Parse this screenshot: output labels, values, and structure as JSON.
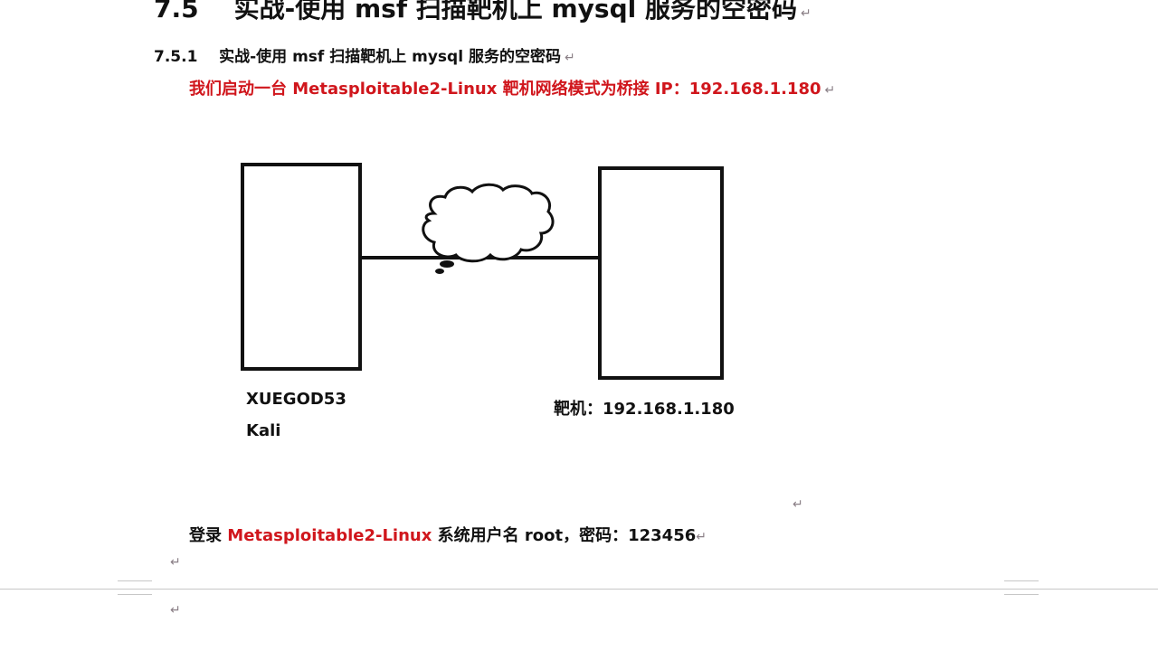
{
  "heading": {
    "number": "7.5",
    "title": "实战-使用 msf 扫描靶机上 mysql 服务的空密码"
  },
  "subheading": {
    "number": "7.5.1",
    "title": "实战-使用 msf 扫描靶机上 mysql 服务的空密码"
  },
  "intro": "我们启动一台 Metasploitable2-Linux 靶机网络模式为桥接 IP：192.168.1.180",
  "diagram": {
    "left_label_line1": "XUEGOD53",
    "left_label_line2": "Kali",
    "right_label": "靶机：192.168.1.180"
  },
  "login": {
    "prefix": "登录 ",
    "highlight": "Metasploitable2-Linux",
    "suffix": " 系统用户名 root，密码：123456"
  },
  "paragraph_mark": "↵",
  "colors": {
    "highlight": "#d0161c",
    "text": "#111111",
    "mark": "#8a7f86"
  }
}
